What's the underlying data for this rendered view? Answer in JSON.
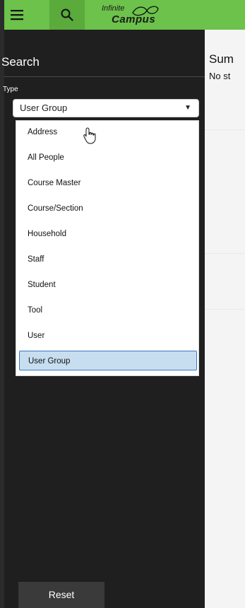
{
  "header": {
    "logo_line1": "Infinite",
    "logo_line2": "Campus",
    "menu_icon": "hamburger-menu-icon",
    "search_icon": "search-icon",
    "brand_color": "#6cc24a"
  },
  "sidebar": {
    "title": "Search",
    "type_label": "Type",
    "selected_type": "User Group",
    "options": [
      {
        "label": "Address"
      },
      {
        "label": "All People"
      },
      {
        "label": "Course Master"
      },
      {
        "label": "Course/Section"
      },
      {
        "label": "Household"
      },
      {
        "label": "Staff"
      },
      {
        "label": "Student"
      },
      {
        "label": "Tool"
      },
      {
        "label": "User"
      },
      {
        "label": "User Group"
      }
    ],
    "reset_label": "Reset"
  },
  "main": {
    "title": "Sum",
    "subtitle": "No st"
  },
  "colors": {
    "sidebar_bg": "#1f1f1f",
    "selected_option_bg": "#c7def0",
    "selected_option_border": "#3a7abf"
  }
}
